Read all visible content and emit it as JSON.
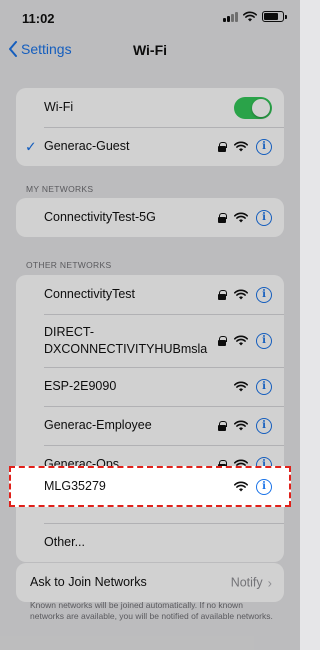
{
  "status_bar": {
    "time": "11:02"
  },
  "nav": {
    "back_label": "Settings",
    "title": "Wi-Fi"
  },
  "wifi_toggle": {
    "label": "Wi-Fi",
    "on": true
  },
  "connected": {
    "name": "Generac-Guest"
  },
  "my_networks": {
    "header": "MY NETWORKS",
    "items": [
      {
        "name": "ConnectivityTest-5G"
      }
    ]
  },
  "other_networks": {
    "header": "OTHER NETWORKS",
    "items": [
      {
        "name": "ConnectivityTest",
        "locked": true
      },
      {
        "name": "DIRECT-DXCONNECTIVITYHUBmsla",
        "line1": "DIRECT-",
        "line2": "DXCONNECTIVITYHUBmsla",
        "locked": true
      },
      {
        "name": "ESP-2E9090",
        "locked": false
      },
      {
        "name": "Generac-Employee",
        "locked": true
      },
      {
        "name": "Generac-Ops",
        "locked": true
      },
      {
        "name": "MLG35279",
        "locked": false,
        "highlighted": true
      },
      {
        "name": "Other..."
      }
    ]
  },
  "ask_to_join": {
    "label": "Ask to Join Networks",
    "value": "Notify"
  },
  "footnote": "Known networks will be joined automatically. If no known networks are available, you will be notified of available networks.",
  "icons": {
    "info": "i",
    "check": "✓"
  },
  "colors": {
    "accent": "#1a73e8",
    "toggle_on": "#34c759",
    "highlight_border": "#e0201a"
  }
}
